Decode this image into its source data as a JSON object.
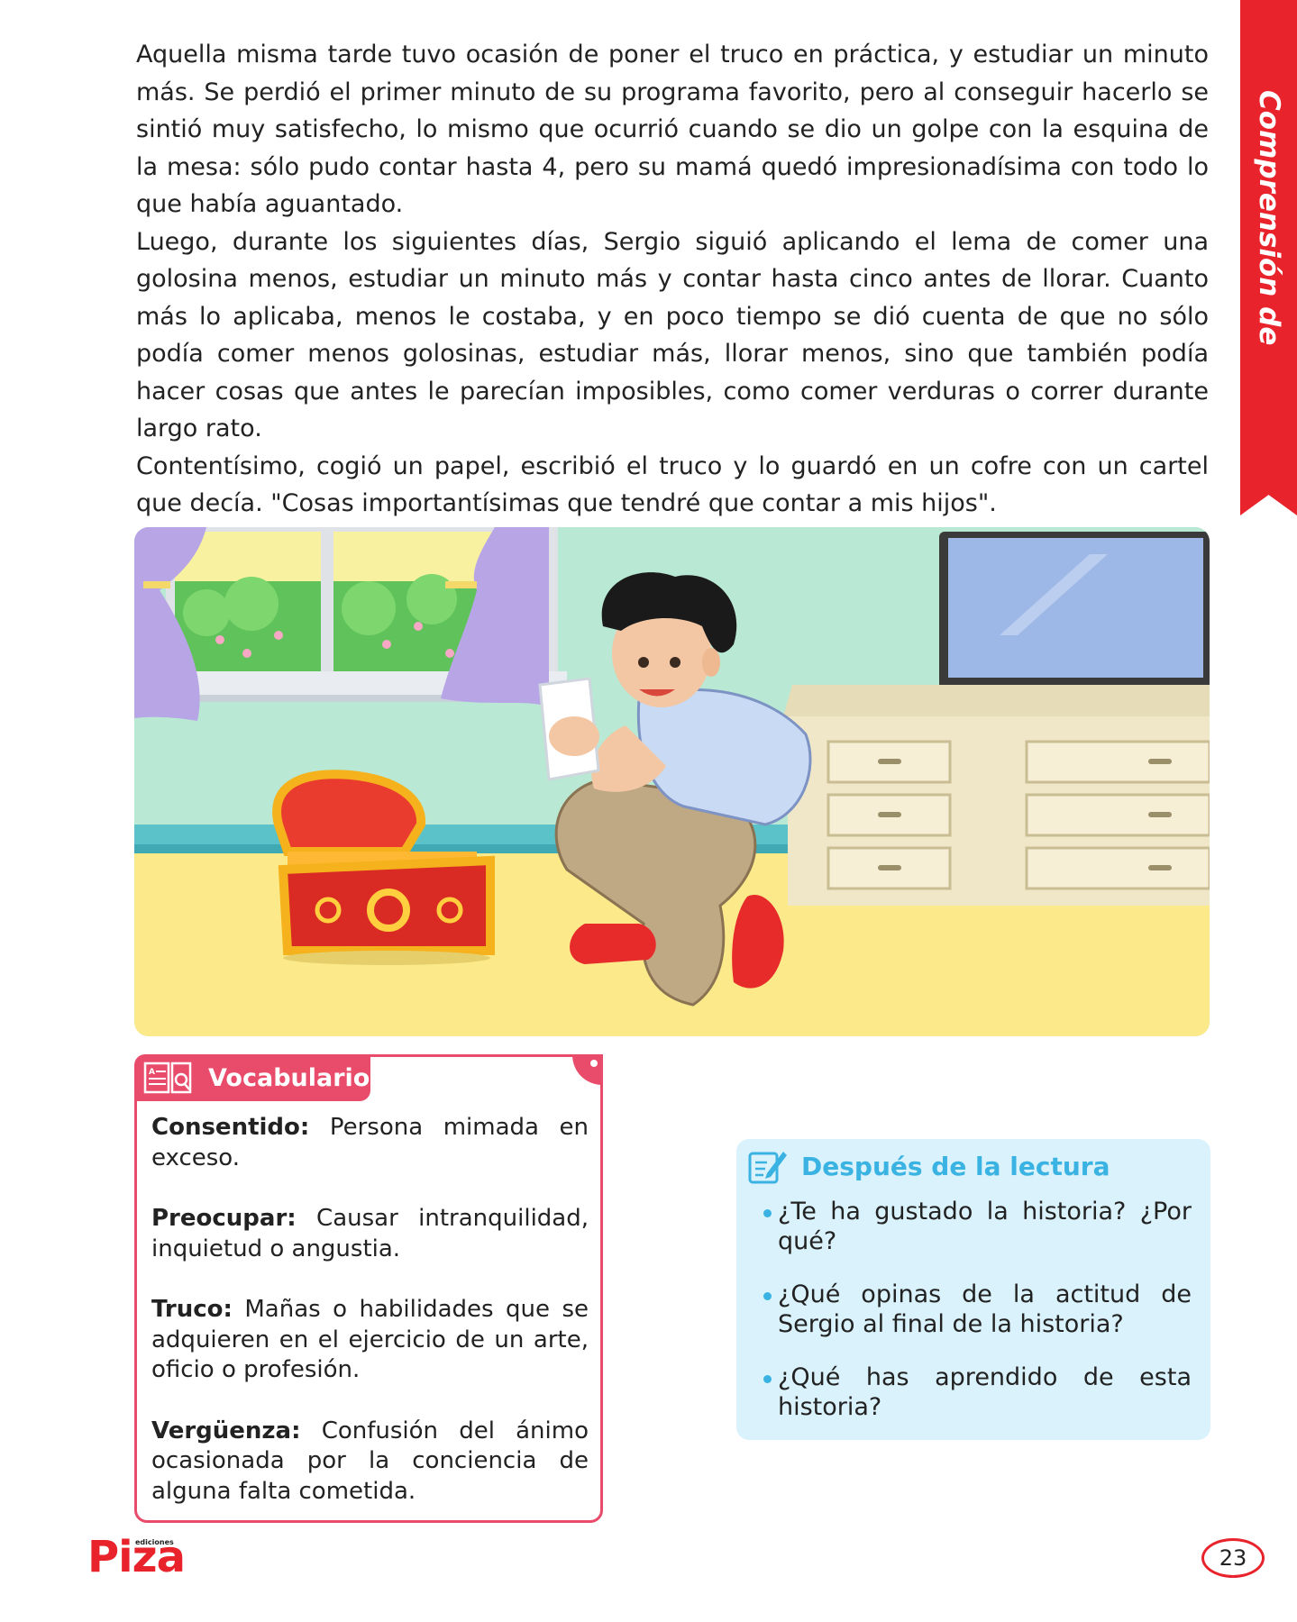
{
  "ribbon": {
    "label": "Comprensión de textos"
  },
  "story": {
    "paragraphs": [
      "Aquella misma tarde tuvo ocasión de poner el truco en práctica, y estudiar un minuto más. Se perdió el primer minuto de su programa favorito, pero al conseguir hacerlo se sintió muy satisfecho, lo mismo que ocurrió cuando se dio un golpe con la esquina de la mesa: sólo pudo contar hasta 4, pero su mamá quedó impresionadísima con todo lo que había aguantado.",
      "Luego, durante los siguientes días, Sergio siguió aplicando el lema de comer una golosina menos, estudiar un minuto más y contar hasta cinco antes de llorar. Cuanto más lo aplicaba, menos le costaba, y en poco tiempo se dió cuenta de que no sólo podía comer menos golosinas, estudiar más, llorar menos, sino que también podía hacer cosas que antes le parecían imposibles, como comer verduras o correr durante largo rato.",
      "Contentísimo, cogió un papel, escribió el truco y lo guardó en un cofre con un cartel que decía. \"Cosas importantísimas que tendré que contar a mis hijos\"."
    ]
  },
  "vocabulary": {
    "title": "Vocabulario",
    "items": [
      {
        "term": "Consentido:",
        "definition": " Persona mimada en exceso."
      },
      {
        "term": "Preocupar:",
        "definition": " Causar intranquilidad, inquietud o angustia."
      },
      {
        "term": "Truco:",
        "definition": " Mañas o habilidades que se adquieren en el ejercicio de un arte, oficio o profesión."
      },
      {
        "term": "Vergüenza:",
        "definition": " Confusión del ánimo ocasionada por la conciencia de alguna falta cometida."
      }
    ]
  },
  "after_reading": {
    "title": "Después de la lectura",
    "questions": [
      "¿Te ha gustado la historia? ¿Por qué?",
      "¿Qué opinas de la actitud de Sergio al final de la historia?",
      "¿Qué has aprendido de esta historia?"
    ]
  },
  "footer": {
    "logo_small": "ediciones",
    "logo_main": "Piza",
    "page_number": "23"
  },
  "colors": {
    "ribbon": "#e8232b",
    "vocab_accent": "#e84c6a",
    "after_accent": "#3ab3e3",
    "after_bg": "#d9f2fb"
  }
}
